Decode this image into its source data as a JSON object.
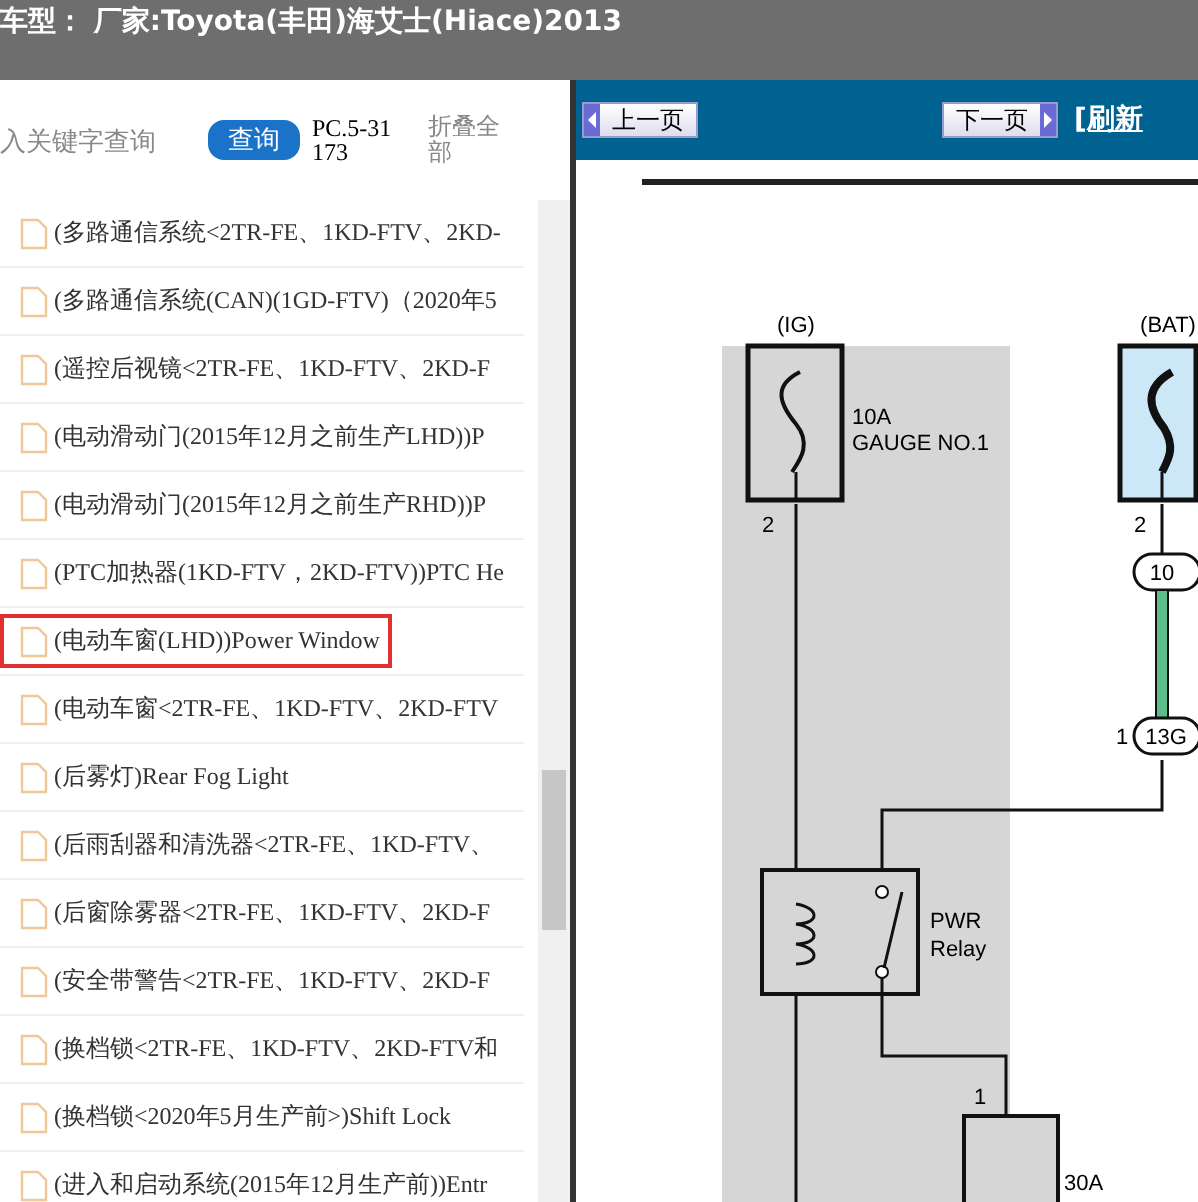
{
  "header": {
    "title": "车型： 厂家:Toyota(丰田)海艾士(Hiace)2013"
  },
  "search": {
    "placeholder": "入关键字查询",
    "button": "查询",
    "code": "PC.5-31173",
    "collapse": "折叠全部"
  },
  "list": [
    {
      "label": "(多路通信系统<2TR-FE、1KD-FTV、2KD-",
      "selected": false
    },
    {
      "label": "(多路通信系统(CAN)(1GD-FTV)（2020年5",
      "selected": false
    },
    {
      "label": "(遥控后视镜<2TR-FE、1KD-FTV、2KD-F",
      "selected": false
    },
    {
      "label": "(电动滑动门(2015年12月之前生产LHD))P",
      "selected": false
    },
    {
      "label": "(电动滑动门(2015年12月之前生产RHD))P",
      "selected": false
    },
    {
      "label": "(PTC加热器(1KD-FTV，2KD-FTV))PTC He",
      "selected": false
    },
    {
      "label": "(电动车窗(LHD))Power Window",
      "selected": true
    },
    {
      "label": "(电动车窗<2TR-FE、1KD-FTV、2KD-FTV",
      "selected": false
    },
    {
      "label": "(后雾灯)Rear Fog Light",
      "selected": false
    },
    {
      "label": "(后雨刮器和清洗器<2TR-FE、1KD-FTV、",
      "selected": false
    },
    {
      "label": "(后窗除雾器<2TR-FE、1KD-FTV、2KD-F",
      "selected": false
    },
    {
      "label": "(安全带警告<2TR-FE、1KD-FTV、2KD-F",
      "selected": false
    },
    {
      "label": "(换档锁<2TR-FE、1KD-FTV、2KD-FTV和",
      "selected": false
    },
    {
      "label": "(换档锁<2020年5月生产前>)Shift Lock",
      "selected": false
    },
    {
      "label": "(进入和启动系统(2015年12月生产前))Entr",
      "selected": false
    }
  ],
  "viewer": {
    "prev": "上一页",
    "next": "下一页",
    "refresh": "[刷新"
  },
  "diagram": {
    "ig_label": "(IG)",
    "ig_fuse": "10A",
    "ig_fuse_name": "GAUGE NO.1",
    "ig_pin": "2",
    "bat_label": "(BAT)",
    "bat_pin": "2",
    "connector_a": "10",
    "connector_b": "13G",
    "connector_b_pin": "1",
    "relay_1": "PWR",
    "relay_2": "Relay",
    "fuse_pin": "1",
    "fuse": "30A"
  }
}
